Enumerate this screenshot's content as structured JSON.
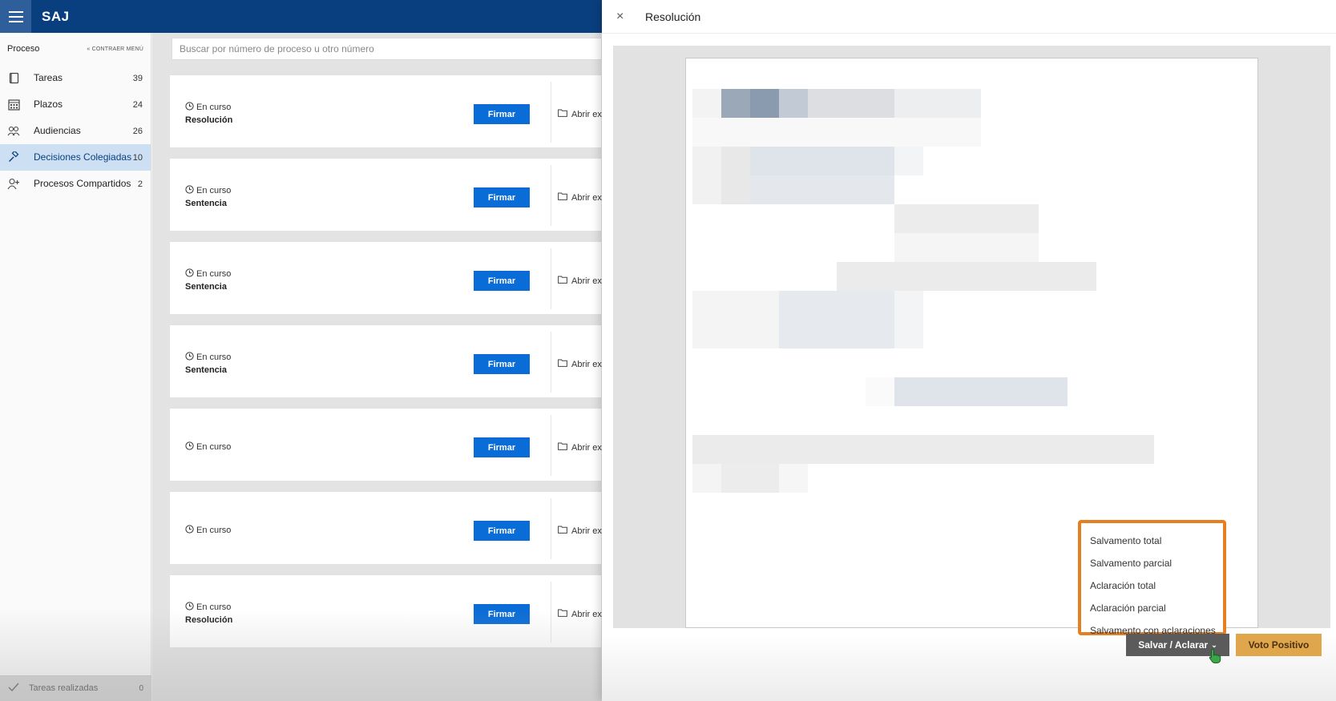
{
  "app": {
    "brand": "SAJ"
  },
  "sidebar": {
    "title": "Proceso",
    "collapse_label": "CONTRAER MENÚ",
    "items": [
      {
        "label": "Tareas",
        "count": "39",
        "icon": "clipboard-icon"
      },
      {
        "label": "Plazos",
        "count": "24",
        "icon": "calendar-icon"
      },
      {
        "label": "Audiencias",
        "count": "26",
        "icon": "people-icon"
      },
      {
        "label": "Decisiones Colegiadas",
        "count": "10",
        "icon": "gavel-icon",
        "active": true
      },
      {
        "label": "Procesos Compartidos",
        "count": "2",
        "icon": "shared-user-icon"
      }
    ],
    "footer": {
      "label": "Tareas realizadas",
      "count": "0"
    }
  },
  "main": {
    "search_placeholder": "Buscar por número de proceso u otro número",
    "cards": [
      {
        "status": "En curso",
        "type": "Resolución",
        "sign_label": "Firmar",
        "open_label": "Abrir expediente"
      },
      {
        "status": "En curso",
        "type": "Sentencia",
        "sign_label": "Firmar",
        "open_label": "Abrir expediente"
      },
      {
        "status": "En curso",
        "type": "Sentencia",
        "sign_label": "Firmar",
        "open_label": "Abrir expediente"
      },
      {
        "status": "En curso",
        "type": "Sentencia",
        "sign_label": "Firmar",
        "open_label": "Abrir expediente"
      },
      {
        "status": "En curso",
        "type": "",
        "sign_label": "Firmar",
        "open_label": "Abrir expediente"
      },
      {
        "status": "En curso",
        "type": "",
        "sign_label": "Firmar",
        "open_label": "Abrir expediente"
      },
      {
        "status": "En curso",
        "type": "Resolución",
        "sign_label": "Firmar",
        "open_label": "Abrir expediente"
      }
    ]
  },
  "panel": {
    "title": "Resolución",
    "close_icon": "close-icon",
    "dropdown_options": [
      "Salvamento total",
      "Salvamento parcial",
      "Aclaración total",
      "Aclaración parcial",
      "Salvamento con aclaraciones"
    ],
    "salvar_label": "Salvar / Aclarar",
    "voto_label": "Voto Positivo"
  },
  "colors": {
    "topbar": "#0a3f7f",
    "primary_button": "#0a6cd6",
    "highlight_border": "#e67e22",
    "voto_button": "#e0a64b",
    "salvar_button": "#5b5b5b"
  }
}
